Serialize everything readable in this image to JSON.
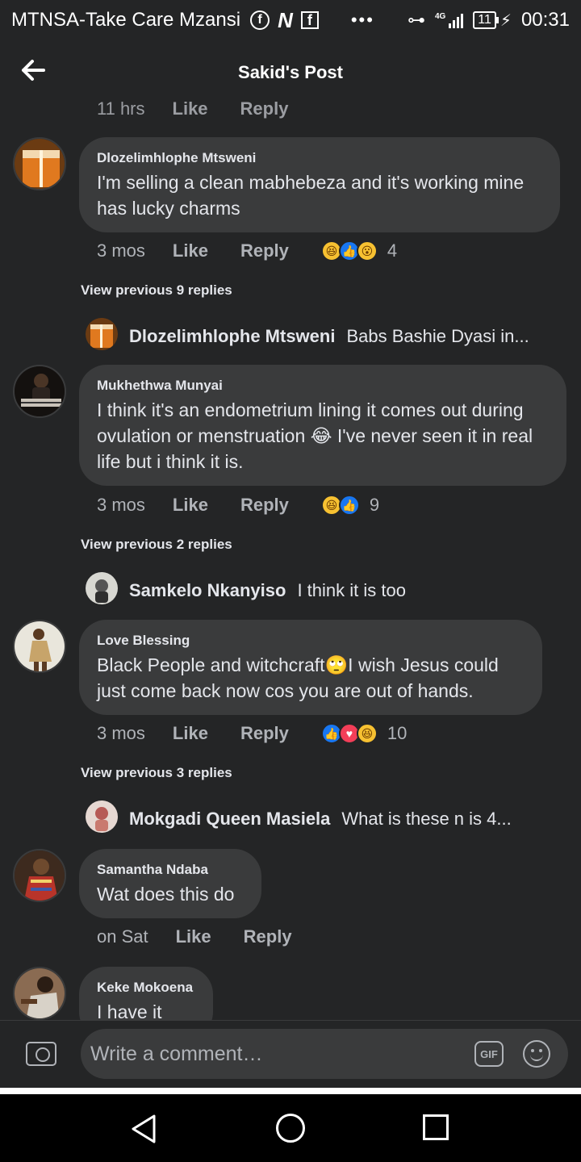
{
  "status_bar": {
    "carrier": "MTNSA-Take Care Mzansi",
    "network": "4G",
    "battery": "11",
    "time": "00:31"
  },
  "header": {
    "title": "Sakid's Post"
  },
  "top_partial": {
    "time": "11 hrs",
    "like": "Like",
    "reply": "Reply"
  },
  "comments": [
    {
      "name": "Dlozelimhlophe Mtsweni",
      "text": "I'm selling a clean mabhebeza and it's working mine has lucky charms",
      "time": "3 mos",
      "like": "Like",
      "reply": "Reply",
      "reactions": [
        "haha",
        "like",
        "wow"
      ],
      "count": "4",
      "view_previous": "View previous 9 replies",
      "preview_name": "Dlozelimhlophe Mtsweni",
      "preview_text": "Babs Bashie Dyasi in..."
    },
    {
      "name": "Mukhethwa Munyai",
      "text": "I think it's an endometrium lining it comes out during ovulation or menstruation 😂 I've never seen it in real life but i think it is.",
      "time": "3 mos",
      "like": "Like",
      "reply": "Reply",
      "reactions": [
        "haha",
        "like"
      ],
      "count": "9",
      "view_previous": "View previous 2 replies",
      "preview_name": "Samkelo Nkanyiso",
      "preview_text": "I think it is too"
    },
    {
      "name": "Love Blessing",
      "text": "Black People and witchcraft🙄I wish Jesus could just come back now cos you are out of hands.",
      "time": "3 mos",
      "like": "Like",
      "reply": "Reply",
      "reactions": [
        "like",
        "love",
        "haha"
      ],
      "count": "10",
      "view_previous": "View previous 3 replies",
      "preview_name": "Mokgadi Queen Masiela",
      "preview_text": "What is  these n is 4..."
    },
    {
      "name": "Samantha Ndaba",
      "text": "Wat does this do",
      "time": "on Sat",
      "like": "Like",
      "reply": "Reply"
    },
    {
      "name": "Keke Mokoena",
      "text": "I have it"
    }
  ],
  "composer": {
    "placeholder": "Write a comment…",
    "gif_label": "GIF"
  },
  "colors": {
    "background": "#242526",
    "bubble": "#3a3b3c",
    "text": "#e4e6eb",
    "secondary": "#b0b3b8",
    "like_blue": "#1877f2",
    "love_red": "#f33e58",
    "haha_yellow": "#f7c131"
  },
  "icons": [
    "back-arrow-icon",
    "camera-icon",
    "gif-icon",
    "emoji-icon",
    "nav-back-icon",
    "nav-home-icon",
    "nav-recents-icon"
  ]
}
